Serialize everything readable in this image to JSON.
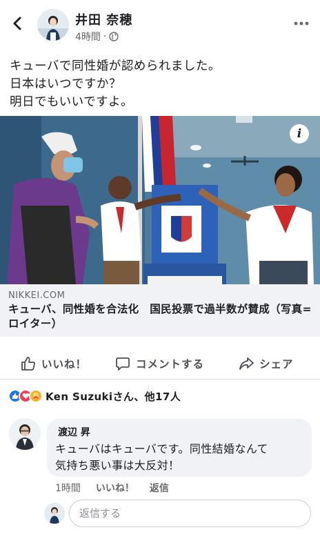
{
  "post": {
    "author": "井田 奈穂",
    "time": "4時間",
    "lines": [
      "キューバで同性婚が認められました。",
      "日本はいつですか？",
      "明日でもいいですよ。"
    ]
  },
  "link": {
    "domain": "NIKKEI.COM",
    "title": "キューバ、同性婚を合法化　国民投票で過半数が賛成（写真=ロイター）"
  },
  "actions": {
    "like": "いいね！",
    "comment": "コメントする",
    "share": "シェア"
  },
  "reactions": {
    "summary": "Ken Suzukiさん、他17人",
    "types": [
      "like",
      "love",
      "care"
    ]
  },
  "comment": {
    "author": "渡辺 昇",
    "lines": [
      "キューバはキューバです。同性結婚なんて",
      "気持ち悪い事は大反対！"
    ],
    "time": "1時間",
    "like": "いいね！",
    "reply": "返信"
  },
  "reply_box": {
    "placeholder": "返信する"
  },
  "icons": {
    "back": "chevron-left-icon",
    "more": "more-horizontal-icon",
    "audience": "globe-icon",
    "info": "info-icon"
  },
  "colors": {
    "text": "#1c1e21",
    "secondary": "#65676b",
    "like_blue": "#1877f2",
    "love_red": "#f33e58",
    "care_yellow": "#f7b125",
    "surface": "#f0f2f5"
  }
}
